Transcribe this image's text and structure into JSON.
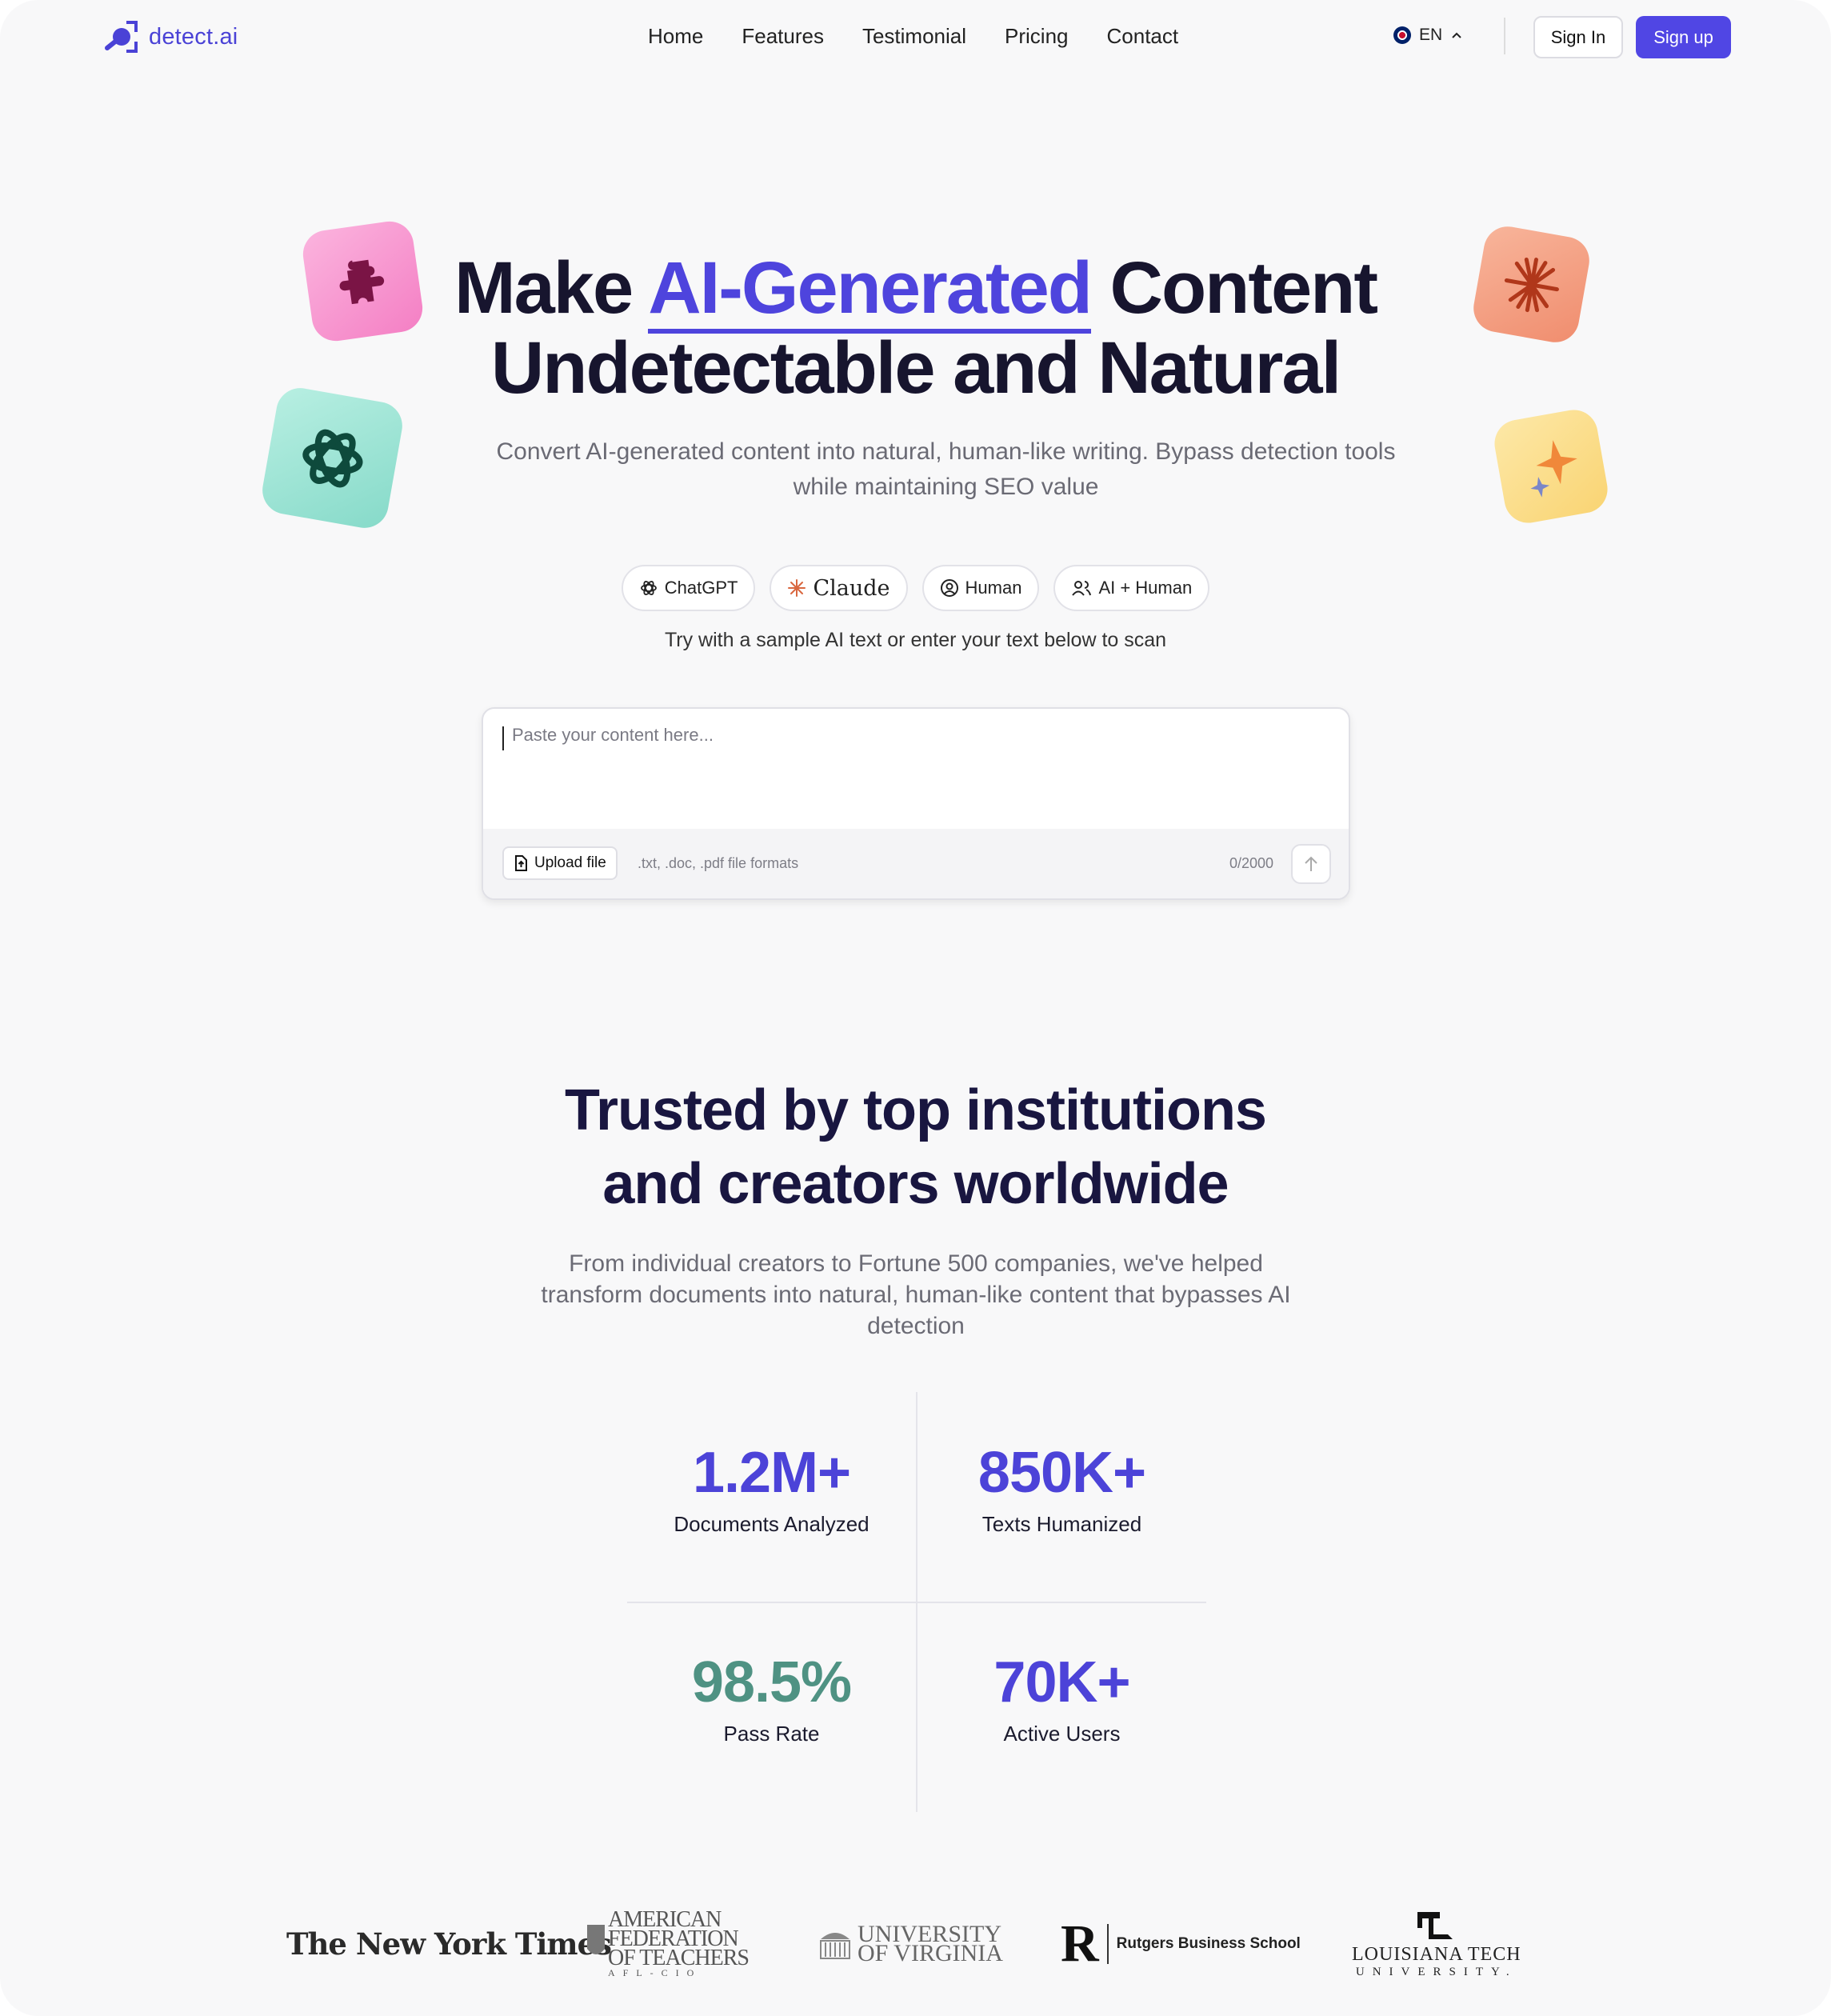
{
  "brand": {
    "name": "detect.ai",
    "accent": "#5046e4"
  },
  "nav": {
    "items": [
      "Home",
      "Features",
      "Testimonial",
      "Pricing",
      "Contact"
    ],
    "language": "EN",
    "sign_in": "Sign In",
    "sign_up": "Sign up"
  },
  "hero": {
    "title_pre": "Make ",
    "title_accent": "AI-Generated",
    "title_post": " Content",
    "title_line2": "Undetectable and Natural",
    "subtitle": "Convert AI-generated content into natural, human-like writing. Bypass detection tools while maintaining SEO value",
    "chips": [
      {
        "label": "ChatGPT",
        "icon": "openai-icon"
      },
      {
        "label": "Claude",
        "icon": "claude-sparkle-icon"
      },
      {
        "label": "Human",
        "icon": "user-circle-icon"
      },
      {
        "label": "AI + Human",
        "icon": "users-icon"
      }
    ],
    "try_text": "Try with a sample AI text or enter your text below to scan"
  },
  "editor": {
    "placeholder": "Paste your content here...",
    "upload_label": "Upload file",
    "formats": ".txt, .doc, .pdf file formats",
    "counter": "0/2000"
  },
  "trust": {
    "title_line1": "Trusted by top institutions",
    "title_line2": "and creators worldwide",
    "subtitle": "From individual creators to Fortune 500 companies, we've helped transform documents into natural, human-like content that bypasses AI detection",
    "stats": [
      {
        "value": "1.2M+",
        "label": "Documents Analyzed",
        "color": "#4c43d8"
      },
      {
        "value": "850K+",
        "label": "Texts Humanized",
        "color": "#4c43d8"
      },
      {
        "value": "98.5%",
        "label": "Pass Rate",
        "color": "#4f9283"
      },
      {
        "value": "70K+",
        "label": "Active Users",
        "color": "#4c43d8"
      }
    ]
  },
  "logos": {
    "nyt": "The New York Times",
    "aft": [
      "American",
      "Federation",
      "of Teachers"
    ],
    "aft_sub": "AFL-CIO",
    "uva": [
      "University",
      "of Virginia"
    ],
    "rutgers": "Rutgers Business School",
    "latech": "LOUISIANA TECH",
    "latech_sub": "UNIVERSITY."
  }
}
